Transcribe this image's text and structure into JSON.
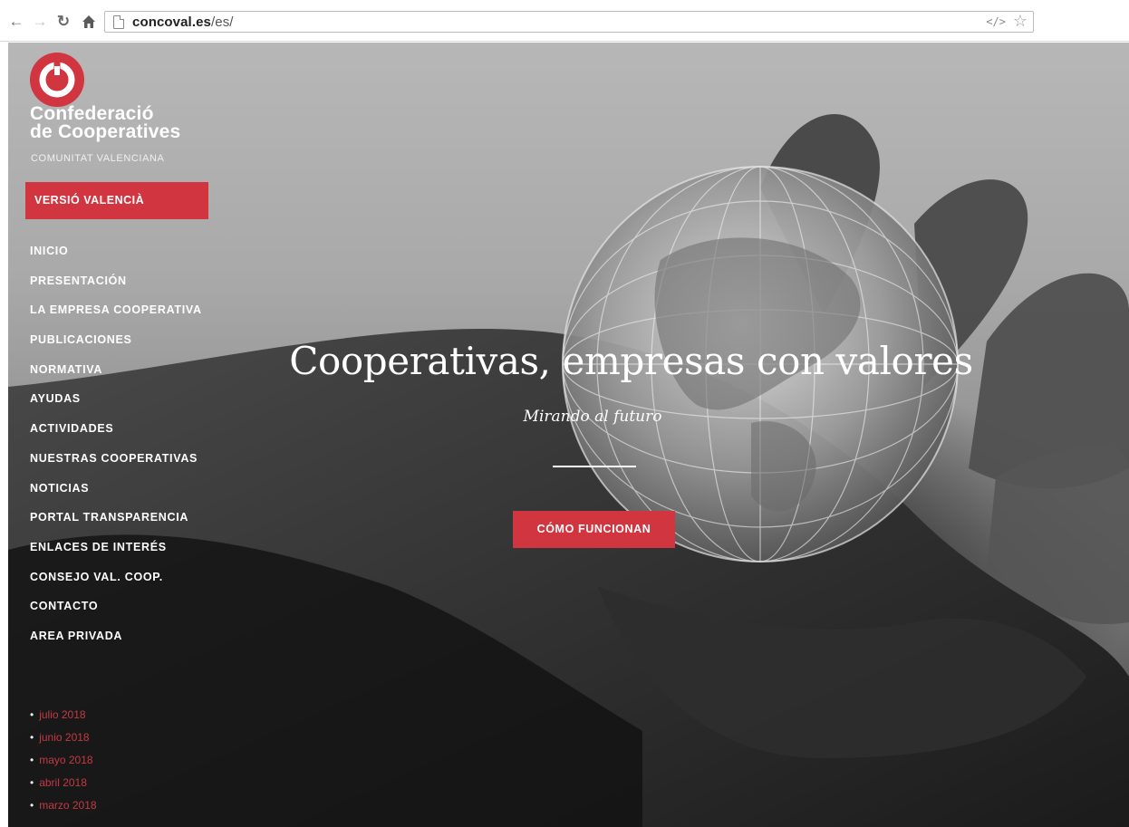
{
  "browser": {
    "back_icon": "arrow-left",
    "forward_icon": "arrow-right",
    "reload_icon": "reload",
    "home_icon": "home",
    "url_host": "concoval.es",
    "url_path": "/es/"
  },
  "colors": {
    "brand_red": "#d13540",
    "archive_link": "#c33a45"
  },
  "site": {
    "org_name_line1": "Confederació",
    "org_name_line2": "de Cooperatives",
    "org_sub": "COMUNITAT VALENCIANA",
    "lang_button": "VERSIÓ VALENCIÀ",
    "menu": [
      "INICIO",
      "PRESENTACIÓN",
      "LA EMPRESA COOPERATIVA",
      "PUBLICACIONES",
      "NORMATIVA",
      "AYUDAS",
      "ACTIVIDADES",
      "NUESTRAS COOPERATIVAS",
      "NOTICIAS",
      "PORTAL TRANSPARENCIA",
      "ENLACES DE INTERÉS",
      "CONSEJO VAL. COOP.",
      "CONTACTO",
      "AREA PRIVADA"
    ],
    "archive": [
      "julio 2018",
      "junio 2018",
      "mayo 2018",
      "abril 2018",
      "marzo 2018"
    ]
  },
  "hero": {
    "title": "Cooperativas, empresas con valores",
    "subtitle": "Mirando al futuro",
    "cta": "CÓMO FUNCIONAN"
  }
}
